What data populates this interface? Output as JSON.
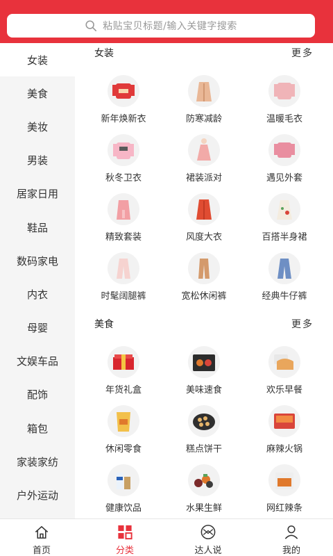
{
  "search": {
    "placeholder": "粘贴宝贝标题/输入关键字搜索"
  },
  "sidebar": {
    "items": [
      {
        "label": "女装",
        "active": true
      },
      {
        "label": "美食"
      },
      {
        "label": "美妆"
      },
      {
        "label": "男装"
      },
      {
        "label": "居家日用"
      },
      {
        "label": "鞋品"
      },
      {
        "label": "数码家电"
      },
      {
        "label": "内衣"
      },
      {
        "label": "母婴"
      },
      {
        "label": "文娱车品"
      },
      {
        "label": "配饰"
      },
      {
        "label": "箱包"
      },
      {
        "label": "家装家纺"
      },
      {
        "label": "户外运动"
      }
    ]
  },
  "sections": [
    {
      "title": "女装",
      "more": "更多",
      "items": [
        {
          "label": "新年焕新衣",
          "icon": "red-sweater"
        },
        {
          "label": "防寒减龄",
          "icon": "beige-coat"
        },
        {
          "label": "温暖毛衣",
          "icon": "pink-sweater"
        },
        {
          "label": "秋冬卫衣",
          "icon": "pink-hoodie"
        },
        {
          "label": "裙装派对",
          "icon": "pink-dress"
        },
        {
          "label": "遇见外套",
          "icon": "pink-jacket"
        },
        {
          "label": "精致套装",
          "icon": "pink-suit"
        },
        {
          "label": "风度大衣",
          "icon": "red-overcoat"
        },
        {
          "label": "百搭半身裙",
          "icon": "floral-skirt"
        },
        {
          "label": "时髦阔腿裤",
          "icon": "wide-pants"
        },
        {
          "label": "宽松休闲裤",
          "icon": "casual-pants"
        },
        {
          "label": "经典牛仔裤",
          "icon": "jeans"
        }
      ]
    },
    {
      "title": "美食",
      "more": "更多",
      "items": [
        {
          "label": "年货礼盒",
          "icon": "gift-box"
        },
        {
          "label": "美味速食",
          "icon": "instant-food"
        },
        {
          "label": "欢乐早餐",
          "icon": "bread"
        },
        {
          "label": "休闲零食",
          "icon": "snack-bag"
        },
        {
          "label": "糕点饼干",
          "icon": "cookies"
        },
        {
          "label": "麻辣火锅",
          "icon": "hotpot"
        },
        {
          "label": "健康饮品",
          "icon": "drinks"
        },
        {
          "label": "水果生鲜",
          "icon": "fruits"
        },
        {
          "label": "网红辣条",
          "icon": "spicy-strips"
        }
      ]
    }
  ],
  "tabbar": {
    "items": [
      {
        "label": "首页",
        "icon": "home-icon"
      },
      {
        "label": "分类",
        "icon": "category-icon",
        "active": true
      },
      {
        "label": "达人说",
        "icon": "talent-icon"
      },
      {
        "label": "我的",
        "icon": "profile-icon"
      }
    ]
  },
  "colors": {
    "accent": "#e8323c",
    "sidebar_bg": "#f5f5f5"
  }
}
